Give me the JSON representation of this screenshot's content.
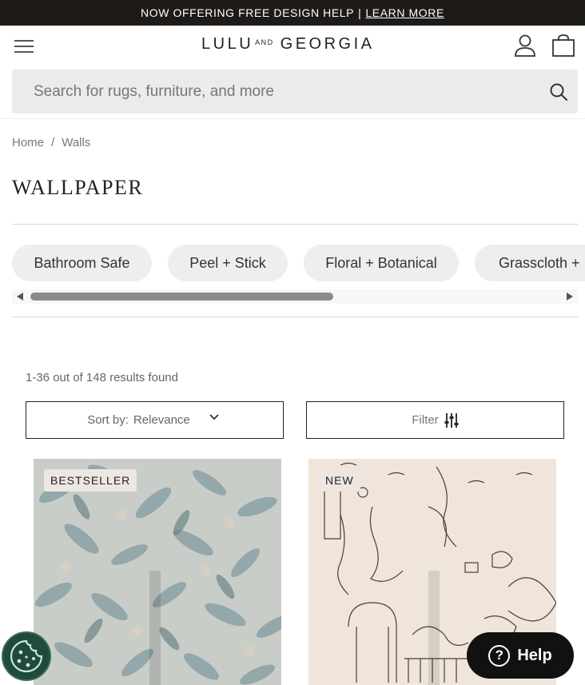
{
  "promo": {
    "text": "NOW OFFERING FREE DESIGN HELP",
    "separator": "|",
    "link": "LEARN MORE"
  },
  "header": {
    "logo": {
      "left": "LULU",
      "mid": "AND",
      "right": "GEORGIA"
    },
    "icons": [
      "menu-icon",
      "account-icon",
      "shopping-bag-icon"
    ]
  },
  "search": {
    "placeholder": "Search for rugs, furniture, and more",
    "icon": "search-icon"
  },
  "breadcrumb": {
    "items": [
      "Home",
      "Walls"
    ],
    "separator": "/"
  },
  "page_title": "WALLPAPER",
  "categories": [
    "Bathroom Safe",
    "Peel + Stick",
    "Floral + Botanical",
    "Grasscloth +"
  ],
  "results": {
    "count_text": "1-36 out of 148 results found"
  },
  "sort": {
    "label": "Sort by:",
    "value": "Relevance"
  },
  "filter": {
    "label": "Filter",
    "icon": "filter-sliders-icon"
  },
  "products": [
    {
      "badge": "BESTSELLER",
      "pattern": "blue-green leaf botanical"
    },
    {
      "badge": "NEW",
      "pattern": "line-drawn mermaids and ruins"
    }
  ],
  "help": {
    "label": "Help",
    "icon": "question-icon"
  },
  "cookie": {
    "icon": "cookie-icon"
  },
  "colors": {
    "promo_bg": "#1e1a17",
    "chip_bg": "#eeeeee",
    "search_bg": "#ebebeb",
    "help_bg": "#111111",
    "cookie_bg": "#1f4a3c"
  }
}
